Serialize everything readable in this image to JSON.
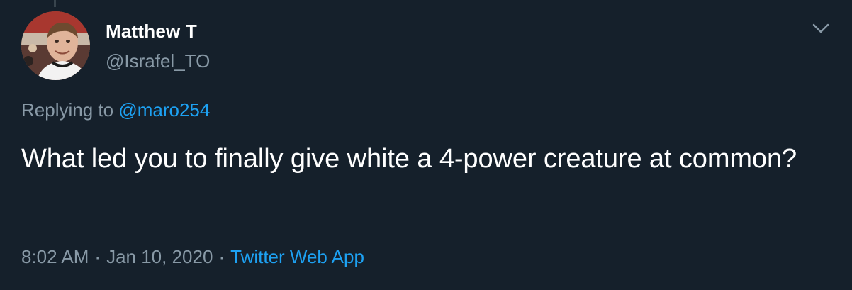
{
  "tweet": {
    "author": {
      "name": "Matthew T",
      "handle": "@Israfel_TO"
    },
    "reply": {
      "prefix": "Replying to",
      "mention": "@maro254"
    },
    "text": "What led you to finally give white a 4-power creature at common?",
    "meta": {
      "time": "8:02 AM",
      "separator": "·",
      "date": "Jan 10, 2020",
      "source": "Twitter Web App"
    }
  },
  "icons": {
    "menu": "chevron-down-icon",
    "avatar": "profile-photo"
  },
  "colors": {
    "background": "#15202b",
    "primary_text": "#ffffff",
    "secondary_text": "#8899a6",
    "accent": "#1da1f2"
  }
}
